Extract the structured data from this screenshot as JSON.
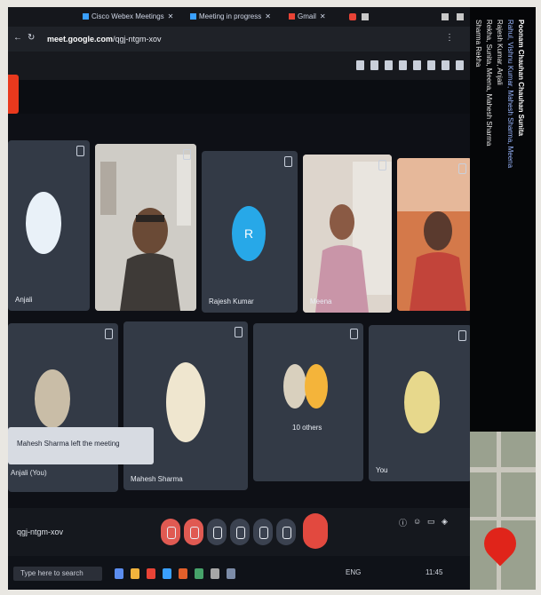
{
  "browser": {
    "tabs": [
      {
        "label": "Cisco Webex Meetings",
        "icon": "webex-icon"
      },
      {
        "label": "Meeting in progress",
        "icon": "webex-icon"
      },
      {
        "label": "Gmail",
        "icon": "gmail-icon"
      }
    ],
    "url_host": "meet.google.com",
    "url_path": "/qgj-ntgm-xov"
  },
  "meeting": {
    "code": "qgj-ntgm-xov",
    "participants": [
      {
        "name": "Anjali",
        "kind": "avatar",
        "color": "#e9f1f8"
      },
      {
        "name": "",
        "kind": "camera",
        "color": "#c9c6c0"
      },
      {
        "name": "Rajesh Kumar",
        "kind": "initial",
        "initial": "R",
        "color": "#27a8e8"
      },
      {
        "name": "Meena",
        "kind": "camera",
        "color": "#d9c9bd"
      },
      {
        "name": "",
        "kind": "camera",
        "color": "#d36a3e"
      },
      {
        "name": "",
        "kind": "avatar",
        "color": "#c9bda7"
      },
      {
        "name": "Mahesh Sharma",
        "kind": "avatar",
        "color": "#efe6cf"
      },
      {
        "name": "10 others",
        "kind": "group",
        "color": "#f4b43a"
      },
      {
        "name": "You",
        "kind": "avatar",
        "color": "#e7d88c"
      }
    ],
    "popup_text": "Mahesh Sharma left the meeting",
    "extra_label": "Anjali (You)"
  },
  "sidebar": {
    "heading": "Poonam Chauhan  Chauhan  Sunita",
    "lines": [
      "Rahul, Vishnu Kumar, Mahesh Sharma, Meena",
      "Rajesh Kumar, Anjali",
      "Rekha, Sunita, Meena, Mahesh Sharma",
      "Sharma Rekha"
    ]
  },
  "taskbar": {
    "search_placeholder": "Type here to search",
    "time": "11:45",
    "lang": "ENG"
  },
  "colors": {
    "end_call": "#e2493f",
    "accent_red": "#e8391d",
    "tile": "#333a46"
  }
}
